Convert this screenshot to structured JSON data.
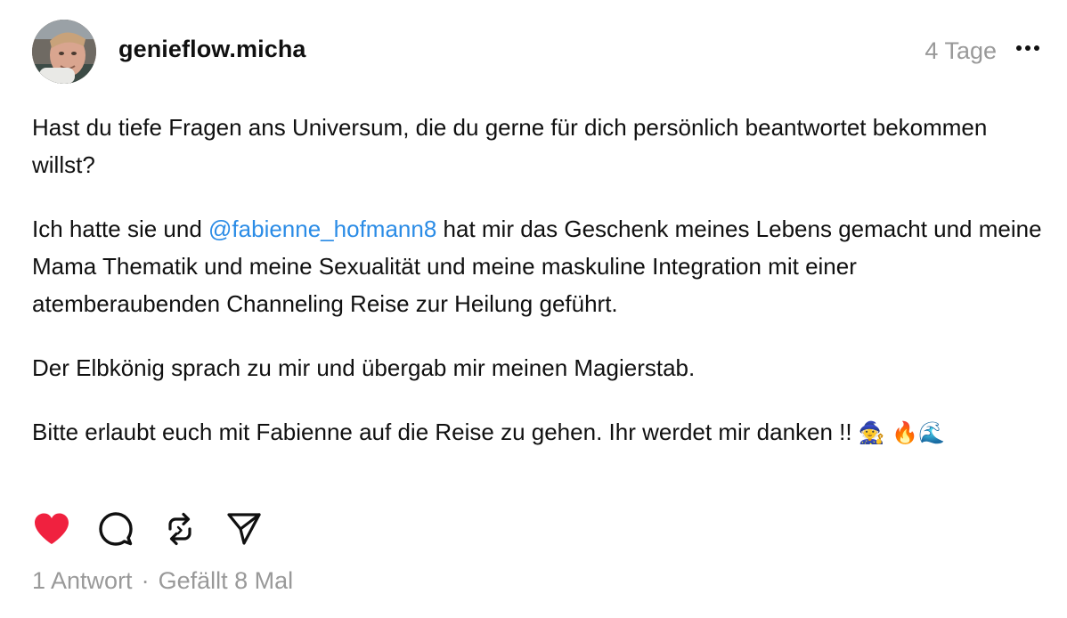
{
  "post": {
    "username": "genieflow.micha",
    "time": "4 Tage",
    "paragraphs": {
      "p1": "Hast du tiefe Fragen ans Universum, die du gerne für dich persönlich beantwortet bekommen willst?",
      "p2_before": "Ich hatte sie und ",
      "p2_mention": "@fabienne_hofmann8",
      "p2_after": " hat mir das Geschenk meines Lebens gemacht und meine Mama Thematik und meine Sexualität und meine maskuline Integration mit einer atemberaubenden Channeling Reise zur Heilung geführt.",
      "p3": "Der Elbkönig sprach zu mir und übergab mir meinen Magierstab.",
      "p4": "Bitte erlaubt euch mit Fabienne auf die Reise zu gehen. Ihr werdet mir danken !! ",
      "p4_emoji": "🧙 🔥🌊"
    },
    "stats": {
      "replies": "1 Antwort",
      "separator": "·",
      "likes": "Gefällt 8 Mal"
    }
  },
  "icons": {
    "more": "more-horizontal-icon",
    "like": "heart-icon",
    "comment": "comment-icon",
    "repost": "repost-icon",
    "share": "send-icon"
  },
  "colors": {
    "like_active": "#f0213f",
    "mention": "#2b8ce6",
    "muted": "#999999",
    "text": "#101010"
  }
}
